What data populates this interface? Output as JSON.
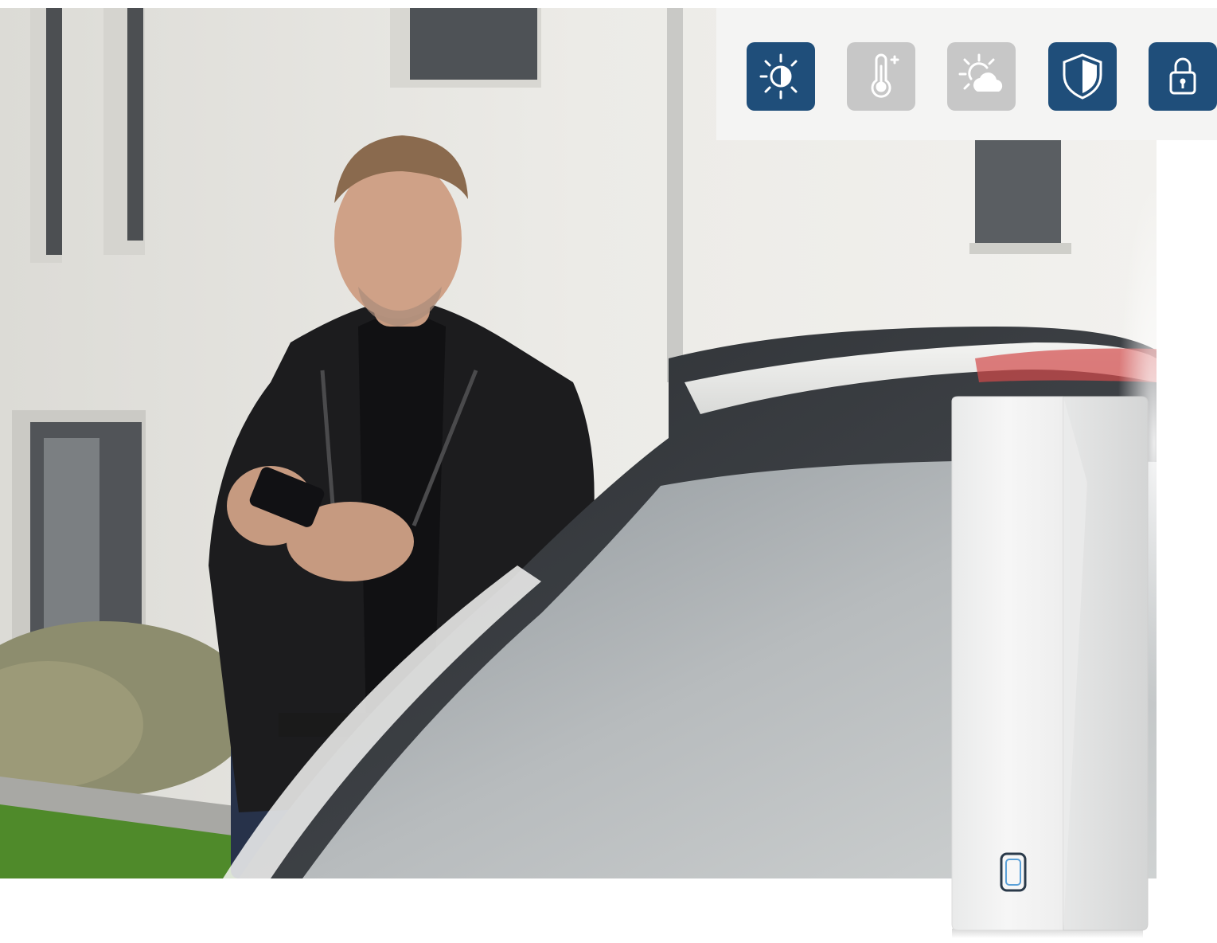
{
  "scene": {
    "subject": "photo-man-with-smartphone-beside-car",
    "product": "white-wall-mounted-sensor"
  },
  "feature_icons": [
    {
      "name": "brightness-icon",
      "state": "active",
      "color": "#1f4e7a"
    },
    {
      "name": "temperature-icon",
      "state": "inactive",
      "color": "#c7c7c7"
    },
    {
      "name": "weather-icon",
      "state": "inactive",
      "color": "#c7c7c7"
    },
    {
      "name": "shield-icon",
      "state": "active",
      "color": "#1f4e7a"
    },
    {
      "name": "lock-icon",
      "state": "active",
      "color": "#1f4e7a"
    }
  ],
  "colors": {
    "accent": "#1f4e7a",
    "inactive": "#c7c7c7",
    "strip_background": "#f4f4f3"
  }
}
